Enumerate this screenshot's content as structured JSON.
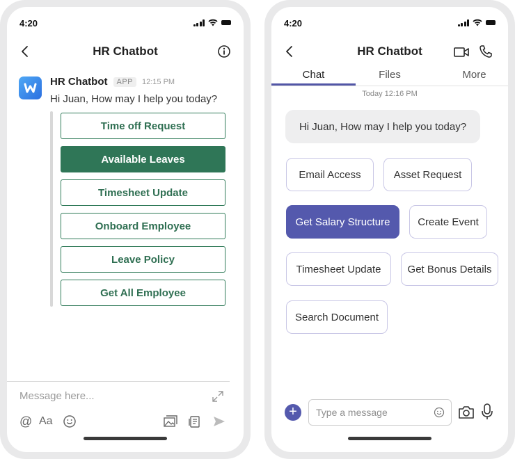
{
  "left": {
    "status_time": "4:20",
    "header_title": "HR Chatbot",
    "message": {
      "sender": "HR Chatbot",
      "tag": "APP",
      "time": "12:15 PM",
      "text": "Hi Juan, How may I help you today?"
    },
    "options": [
      {
        "label": "Time off Request",
        "active": false
      },
      {
        "label": "Available Leaves",
        "active": true
      },
      {
        "label": "Timesheet Update",
        "active": false
      },
      {
        "label": "Onboard Employee",
        "active": false
      },
      {
        "label": "Leave Policy",
        "active": false
      },
      {
        "label": "Get All Employee",
        "active": false
      }
    ],
    "composer_placeholder": "Message here...",
    "format_label": "Aa",
    "mention_label": "@"
  },
  "right": {
    "status_time": "4:20",
    "header_title": "HR Chatbot",
    "tabs": [
      "Chat",
      "Files",
      "More"
    ],
    "active_tab": "Chat",
    "timestamp": "Today 12:16 PM",
    "bubble_text": "Hi Juan, How may I help you today?",
    "chips": [
      {
        "label": "Email Access",
        "active": false
      },
      {
        "label": "Asset Request",
        "active": false
      },
      {
        "label": "Get Salary Structure",
        "active": true
      },
      {
        "label": "Create Event",
        "active": false
      },
      {
        "label": "Timesheet Update",
        "active": false
      },
      {
        "label": "Get Bonus Details",
        "active": false
      },
      {
        "label": "Search Document",
        "active": false
      }
    ],
    "input_placeholder": "Type a message",
    "plus_label": "+"
  },
  "colors": {
    "teams_green": "#2f7657",
    "teams_purple": "#5459ad",
    "chip_border": "#c9c7e6"
  },
  "icons": [
    "back-icon",
    "info-icon",
    "video-icon",
    "phone-icon",
    "expand-icon",
    "emoji-icon",
    "image-icon",
    "attach-icon",
    "send-icon",
    "camera-icon",
    "mic-icon",
    "add-icon"
  ]
}
